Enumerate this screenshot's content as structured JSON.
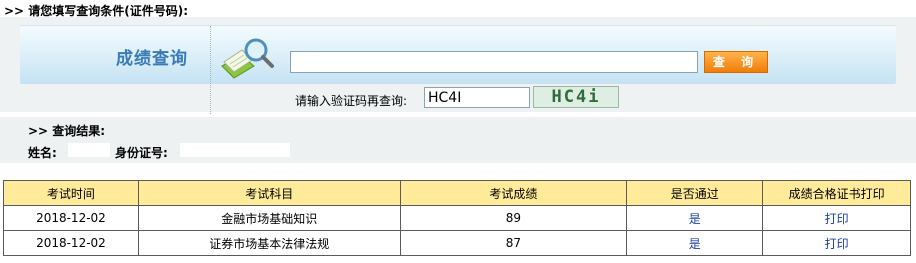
{
  "top_hint": ">> 请您填写查询条件(证件号码):",
  "query": {
    "title": "成绩查询",
    "search_value": "",
    "search_button": "查 询",
    "captcha_label": "请输入验证码再查询:",
    "captcha_value": "HC4I",
    "captcha_image_text": "HC4i"
  },
  "result": {
    "heading": ">> 查询结果:",
    "name_label": "姓名:",
    "id_label": "身份证号:"
  },
  "table": {
    "headers": [
      "考试时间",
      "考试科目",
      "考试成绩",
      "是否通过",
      "成绩合格证书打印"
    ],
    "rows": [
      {
        "date": "2018-12-02",
        "subject": "金融市场基础知识",
        "score": "89",
        "pass": "是",
        "print": "打印"
      },
      {
        "date": "2018-12-02",
        "subject": "证券市场基本法律法规",
        "score": "87",
        "pass": "是",
        "print": "打印"
      }
    ]
  },
  "colors": {
    "accent": "#3a7ab5",
    "button": "#f07d0a",
    "table_header": "#ffeb99",
    "link": "#1a3fa8"
  },
  "icons": [
    "book-magnifier-icon"
  ]
}
